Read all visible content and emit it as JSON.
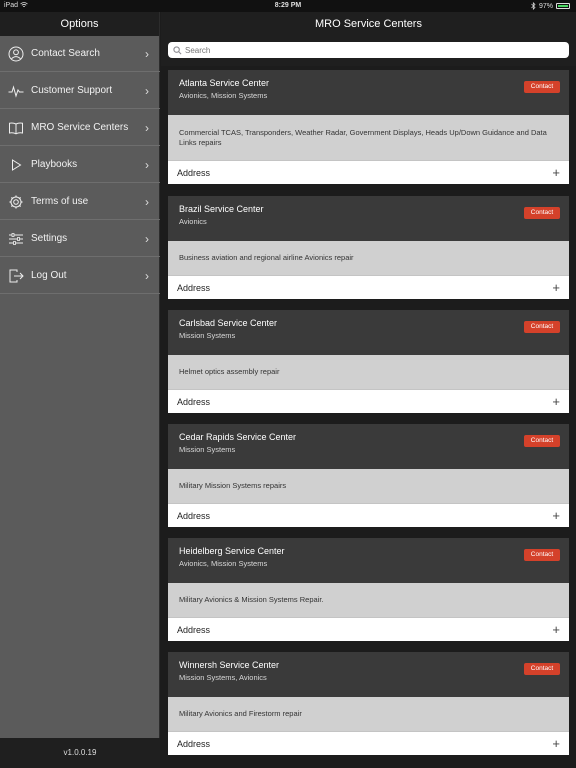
{
  "status": {
    "device": "iPad",
    "time": "8:29 PM",
    "battery": "97%",
    "battery_level": 0.97
  },
  "sidebar": {
    "title": "Options",
    "items": [
      {
        "label": "Contact Search",
        "icon": "user-circle-icon"
      },
      {
        "label": "Customer Support",
        "icon": "pulse-icon"
      },
      {
        "label": "MRO Service Centers",
        "icon": "book-icon"
      },
      {
        "label": "Playbooks",
        "icon": "play-icon"
      },
      {
        "label": "Terms of use",
        "icon": "gear-icon"
      },
      {
        "label": "Settings",
        "icon": "sliders-icon"
      },
      {
        "label": "Log Out",
        "icon": "logout-icon"
      }
    ],
    "version": "v1.0.0.19"
  },
  "main": {
    "title": "MRO Service Centers",
    "search": {
      "placeholder": "Search",
      "value": ""
    },
    "contact_label": "Contact",
    "address_label": "Address",
    "centers": [
      {
        "name": "Atlanta Service Center",
        "specialties": "Avionics, Mission Systems",
        "description": "Commercial TCAS, Transponders, Weather Radar, Government Displays, Heads Up/Down Guidance and Data Links repairs"
      },
      {
        "name": "Brazil Service Center",
        "specialties": "Avionics",
        "description": "Business aviation and regional airline Avionics repair"
      },
      {
        "name": "Carlsbad Service Center",
        "specialties": "Mission Systems",
        "description": "Helmet optics assembly repair"
      },
      {
        "name": "Cedar Rapids Service Center",
        "specialties": "Mission Systems",
        "description": "Military Mission Systems repairs"
      },
      {
        "name": "Heidelberg Service Center",
        "specialties": "Avionics, Mission Systems",
        "description": "Military Avionics & Mission Systems Repair."
      },
      {
        "name": "Winnersh Service Center",
        "specialties": "Mission Systems, Avionics",
        "description": "Military Avionics and Firestorm repair"
      }
    ]
  },
  "colors": {
    "contact_button": "#d4412a",
    "sidebar_bg": "#5b5b5b",
    "card_header": "#3a3a3a",
    "description_bg": "#d0d0d0"
  }
}
